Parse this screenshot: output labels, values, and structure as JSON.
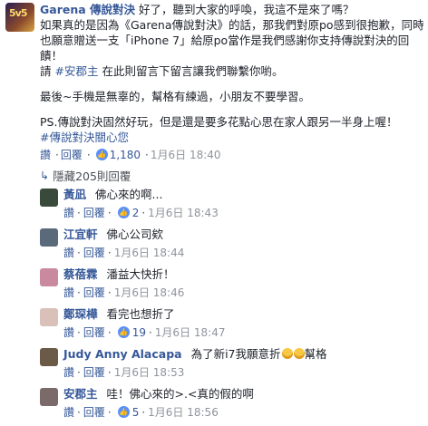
{
  "post": {
    "author": "Garena 傳說對決",
    "line1_rest": "好了，聽到大家的呼喚，我這不是來了嗎？",
    "para1": "如果真的是因為《Garena傳說對決》的話，那我們對原po感到很抱歉，同時也願意贈送一支「iPhone 7」給原po當作是我們感謝你支持傳說對決的回饋！",
    "para2_pre": "請",
    "para2_tag": "#安郡主",
    "para2_post": "在此則留言下留言讓我們聯繫你喲。",
    "para3": "最後~手機是無辜的，幫格有練過，小朋友不要學習。",
    "para4": "PS.傳說對決固然好玩，但是還是要多花點心思在家人跟另一半身上喔！",
    "para4_tag": "#傳說對決關心您",
    "avatar_text": "5v5",
    "actions": {
      "like": "讚",
      "reply": "回覆",
      "count": "1,180",
      "time": "1月6日 18:40"
    }
  },
  "hidden_replies": "隱藏205則回覆",
  "replies": [
    {
      "name": "黃凪",
      "text": "佛心來的啊...",
      "like": "讚",
      "reply": "回覆",
      "count": "2",
      "time": "1月6日 18:43",
      "color": "#3a4a3a"
    },
    {
      "name": "江宜軒",
      "text": "佛心公司欸",
      "like": "讚",
      "reply": "回覆",
      "count": "",
      "time": "1月6日 18:44",
      "color": "#5a6a7a"
    },
    {
      "name": "蔡蓓霖",
      "text": "潘益大快折！",
      "like": "讚",
      "reply": "回覆",
      "count": "",
      "time": "1月6日 18:46",
      "color": "#c98aa0"
    },
    {
      "name": "鄭琛樺",
      "text": "看完也想折了",
      "like": "讚",
      "reply": "回覆",
      "count": "19",
      "time": "1月6日 18:47",
      "color": "#d9c0b8"
    },
    {
      "name": "Judy Anny Alacapa",
      "text": "為了新i7我願意折",
      "text_after": "幫格",
      "like": "讚",
      "reply": "回覆",
      "count": "",
      "time": "1月6日 18:53",
      "color": "#6b5a48"
    },
    {
      "name": "安郡主",
      "text": "哇！佛心來的>.<真的假的啊",
      "like": "讚",
      "reply": "回覆",
      "count": "5",
      "time": "1月6日 18:56",
      "color": "#7a6a6a"
    }
  ]
}
